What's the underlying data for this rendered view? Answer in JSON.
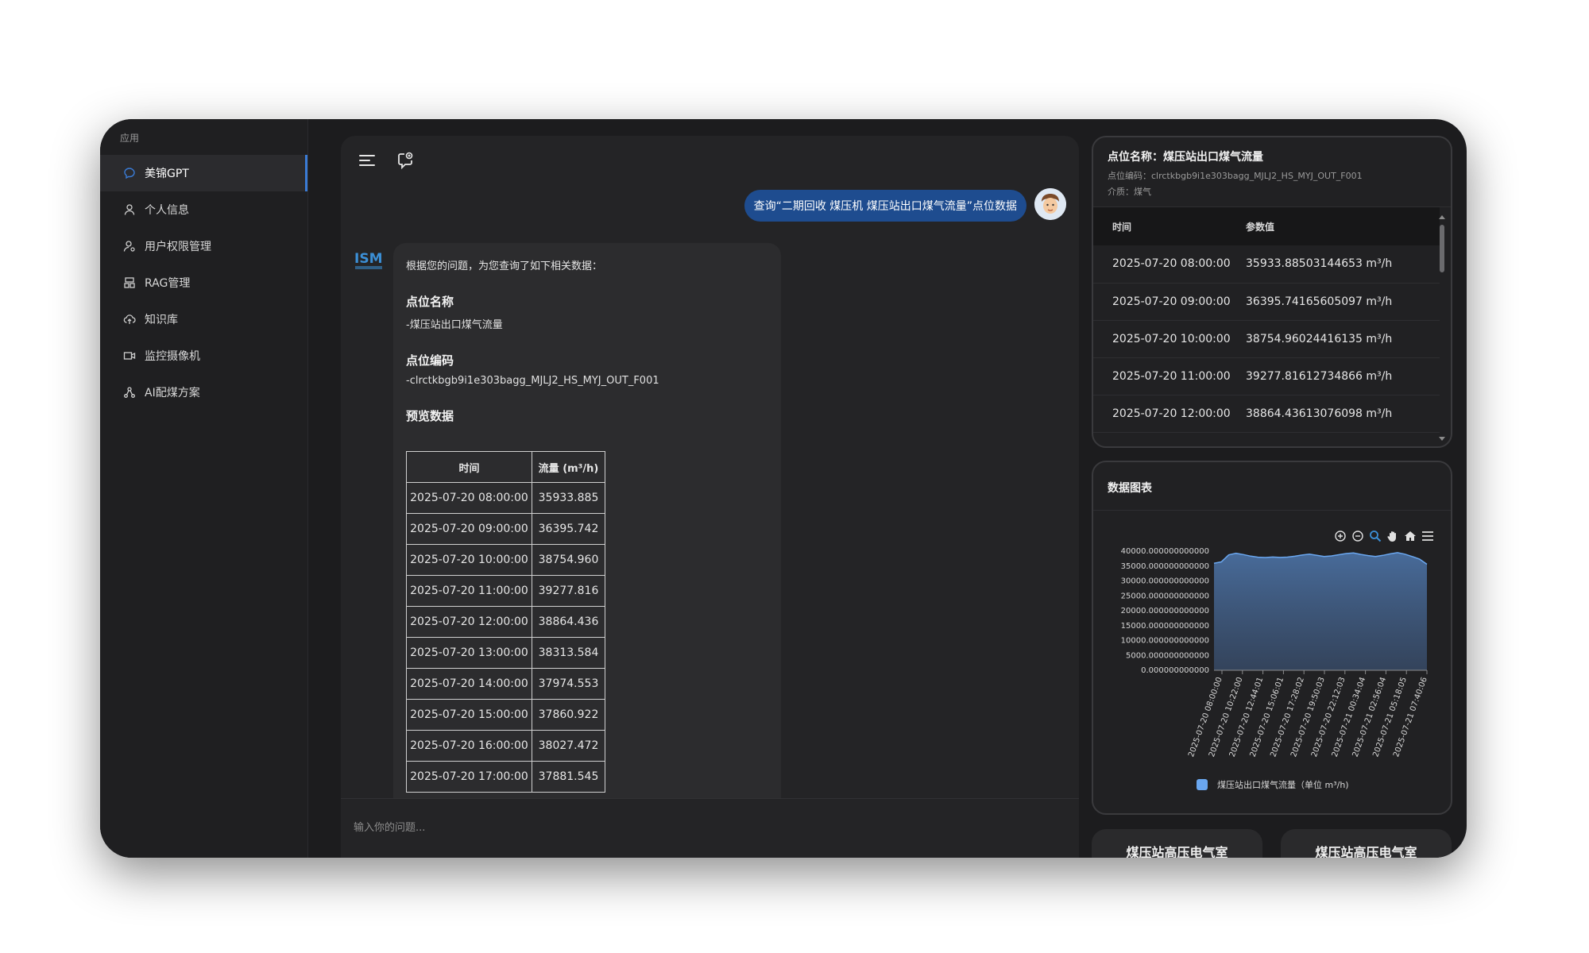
{
  "sidebar": {
    "heading": "应用",
    "items": [
      {
        "label": "美锦GPT",
        "icon": "chat-icon",
        "active": true
      },
      {
        "label": "个人信息",
        "icon": "user-icon"
      },
      {
        "label": "用户权限管理",
        "icon": "user-permission-icon"
      },
      {
        "label": "RAG管理",
        "icon": "rag-icon"
      },
      {
        "label": "知识库",
        "icon": "cloud-upload-icon"
      },
      {
        "label": "监控摄像机",
        "icon": "camera-icon"
      },
      {
        "label": "AI配煤方案",
        "icon": "network-icon"
      }
    ]
  },
  "chat": {
    "user_message": "查询“二期回收 煤压机 煤压站出口煤气流量”点位数据",
    "bot": {
      "intro": "根据您的问题，为您查询了如下相关数据：",
      "point_name_title": "点位名称",
      "point_name_value": "-煤压站出口煤气流量",
      "point_code_title": "点位编码",
      "point_code_value": "-clrctkbgb9i1e303bagg_MJLJ2_HS_MYJ_OUT_F001",
      "preview_title": "预览数据",
      "table_headers": [
        "时间",
        "流量 (m³/h)"
      ],
      "table_rows": [
        [
          "2025-07-20 08:00:00",
          "35933.885"
        ],
        [
          "2025-07-20 09:00:00",
          "36395.742"
        ],
        [
          "2025-07-20 10:00:00",
          "38754.960"
        ],
        [
          "2025-07-20 11:00:00",
          "39277.816"
        ],
        [
          "2025-07-20 12:00:00",
          "38864.436"
        ],
        [
          "2025-07-20 13:00:00",
          "38313.584"
        ],
        [
          "2025-07-20 14:00:00",
          "37974.553"
        ],
        [
          "2025-07-20 15:00:00",
          "37860.922"
        ],
        [
          "2025-07-20 16:00:00",
          "38027.472"
        ],
        [
          "2025-07-20 17:00:00",
          "37881.545"
        ]
      ]
    },
    "input_placeholder": "输入你的问题..."
  },
  "info_card": {
    "title": "点位名称：煤压站出口煤气流量",
    "code_line": "点位编码：clrctkbgb9i1e303bagg_MJLJ2_HS_MYJ_OUT_F001",
    "medium_line": "介质：煤气",
    "headers": [
      "时间",
      "参数值"
    ],
    "rows": [
      [
        "2025-07-20 08:00:00",
        "35933.88503144653 m³/h"
      ],
      [
        "2025-07-20 09:00:00",
        "36395.74165605097 m³/h"
      ],
      [
        "2025-07-20 10:00:00",
        "38754.96024416135 m³/h"
      ],
      [
        "2025-07-20 11:00:00",
        "39277.81612734866 m³/h"
      ],
      [
        "2025-07-20 12:00:00",
        "38864.43613076098 m³/h"
      ]
    ]
  },
  "chart_card": {
    "title": "数据图表",
    "toolbar": [
      "zoom-in-icon",
      "zoom-out-icon",
      "magnifier-icon",
      "pan-hand-icon",
      "home-icon",
      "menu-icon"
    ]
  },
  "chart_data": {
    "type": "area",
    "title": "",
    "xlabel": "",
    "ylabel": "",
    "ylim": [
      0,
      40000
    ],
    "y_ticks": [
      "0.000000000000",
      "5000.000000000000",
      "10000.000000000000",
      "15000.000000000000",
      "20000.000000000000",
      "25000.000000000000",
      "30000.000000000000",
      "35000.000000000000",
      "40000.000000000000"
    ],
    "x_ticks": [
      "2025-07-20 08:00:00",
      "2025-07-20 10:22:00",
      "2025-07-20 12:44:01",
      "2025-07-20 15:06:01",
      "2025-07-20 17:28:02",
      "2025-07-20 19:50:03",
      "2025-07-20 22:12:03",
      "2025-07-21 00:34:04",
      "2025-07-21 02:56:04",
      "2025-07-21 05:18:05",
      "2025-07-21 07:40:06"
    ],
    "series": [
      {
        "name": "煤压站出口煤气流量（单位 m³/h)",
        "color": "#6aa7f0",
        "values": [
          35933.9,
          36395.7,
          38754.9,
          39277.8,
          38864.4,
          38313.6,
          37974.6,
          37860.9,
          38027.5,
          37881.5,
          38000,
          38300,
          38700,
          39000,
          38600,
          38200,
          38400,
          38800,
          39200,
          39400,
          38900,
          38500,
          38200,
          38600,
          39100,
          39500,
          39000,
          38200,
          37300,
          35600
        ]
      }
    ],
    "grid": false,
    "legend_position": "bottom"
  },
  "bottom_buttons": [
    "煤压站高压电气室",
    "煤压站高压电气室"
  ]
}
